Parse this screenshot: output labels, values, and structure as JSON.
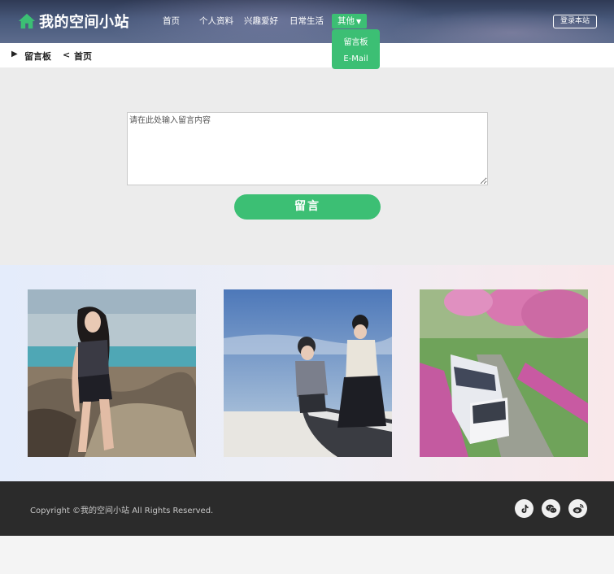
{
  "site": {
    "title": "我的空间小站",
    "home_icon": "house-icon",
    "accent_color": "#3cbf74"
  },
  "nav": {
    "items": [
      {
        "label": "首页"
      },
      {
        "label": "个人资料"
      },
      {
        "label": "兴趣爱好"
      },
      {
        "label": "日常生活"
      },
      {
        "label": "其他",
        "caret": "▼",
        "active": true
      }
    ],
    "dropdown": [
      "留言板",
      "E-Mail"
    ]
  },
  "login_label": "登录本站",
  "breadcrumb": {
    "arrow": "▶",
    "current": "留言板",
    "separator": "<",
    "back": "首页"
  },
  "message": {
    "placeholder": "请在此处输入留言内容",
    "submit_label": "留言"
  },
  "gallery": [
    {
      "name": "photo-girl-beach"
    },
    {
      "name": "photo-two-girls-boat"
    },
    {
      "name": "photo-tram-flowers"
    }
  ],
  "footer": {
    "copyright": "Copyright ©我的空间小站 All Rights Reserved.",
    "social": [
      "tiktok-icon",
      "wechat-icon",
      "weibo-icon"
    ]
  }
}
